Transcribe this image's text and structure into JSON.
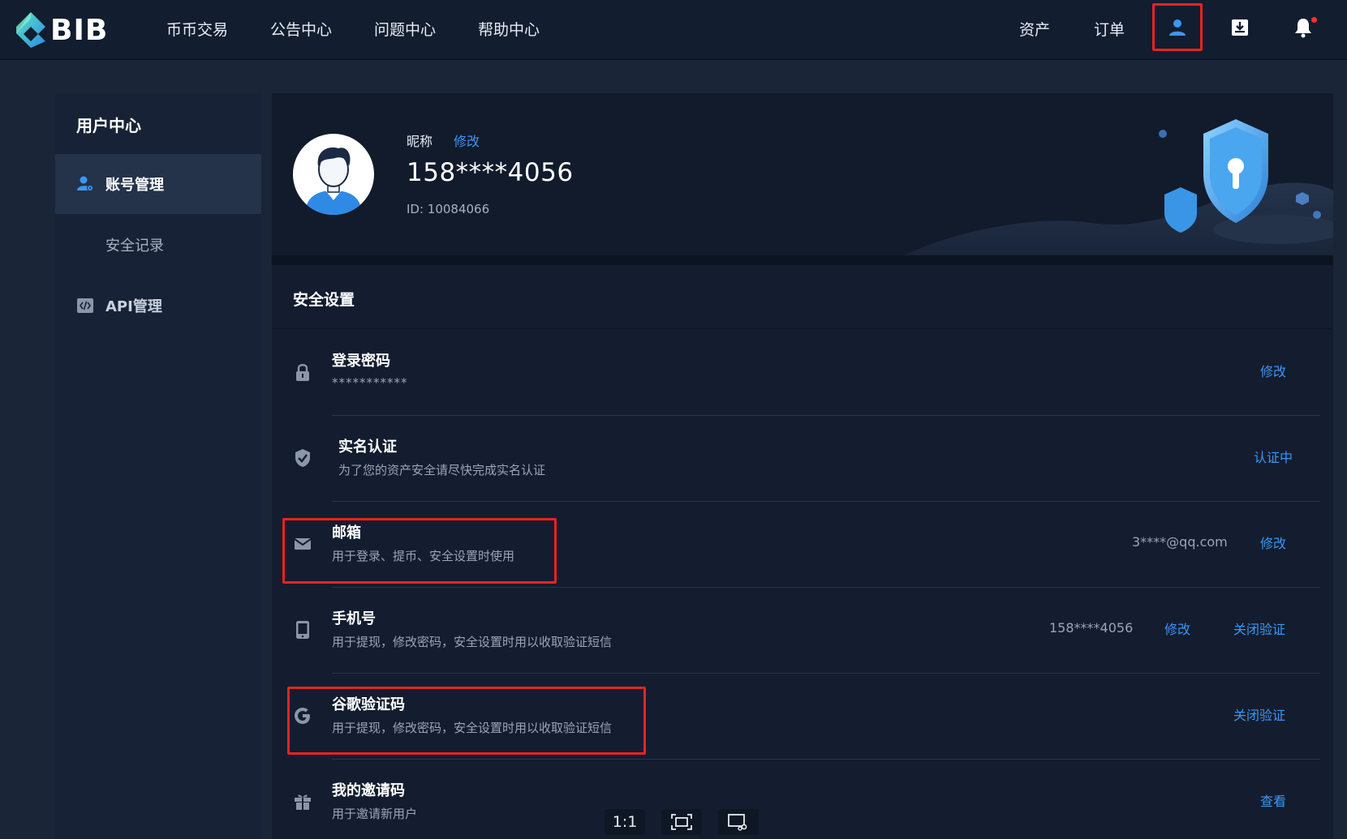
{
  "brand": {
    "name": "BIB"
  },
  "nav": {
    "items": [
      "币币交易",
      "公告中心",
      "问题中心",
      "帮助中心"
    ],
    "right": {
      "assets": "资产",
      "orders": "订单"
    }
  },
  "sidebar": {
    "title": "用户中心",
    "items": [
      {
        "label": "账号管理",
        "icon": "user-gear-icon",
        "active": true
      },
      {
        "label": "安全记录",
        "icon": "",
        "active": false
      },
      {
        "label": "API管理",
        "icon": "code-icon",
        "active": false
      }
    ]
  },
  "profile": {
    "nickname_label": "昵称",
    "nickname_edit": "修改",
    "phone": "158****4056",
    "uid": "ID: 10084066"
  },
  "security": {
    "title": "安全设置",
    "rows": [
      {
        "icon": "lock-icon",
        "title": "登录密码",
        "sub": "***********",
        "value": "",
        "links": [
          "修改"
        ]
      },
      {
        "icon": "shield-check-icon",
        "title": "实名认证",
        "sub": "为了您的资产安全请尽快完成实名认证",
        "value": "",
        "links": [
          "认证中"
        ]
      },
      {
        "icon": "mail-icon",
        "title": "邮箱",
        "sub": "用于登录、提币、安全设置时使用",
        "value": "3****@qq.com",
        "links": [
          "修改"
        ]
      },
      {
        "icon": "phone-icon",
        "title": "手机号",
        "sub": "用于提现，修改密码，安全设置时用以收取验证短信",
        "value": "158****4056",
        "links": [
          "修改",
          "关闭验证"
        ]
      },
      {
        "icon": "google-icon",
        "title": "谷歌验证码",
        "sub": "用于提现，修改密码，安全设置时用以收取验证短信",
        "value": "",
        "links": [
          "关闭验证"
        ]
      },
      {
        "icon": "gift-icon",
        "title": "我的邀请码",
        "sub": "用于邀请新用户",
        "value": "",
        "links": [
          "查看"
        ]
      }
    ]
  },
  "viewer": {
    "actual_size": "1:1"
  },
  "colors": {
    "accent": "#3d96f2",
    "highlight": "#e8231f",
    "background": "#1a2537"
  }
}
